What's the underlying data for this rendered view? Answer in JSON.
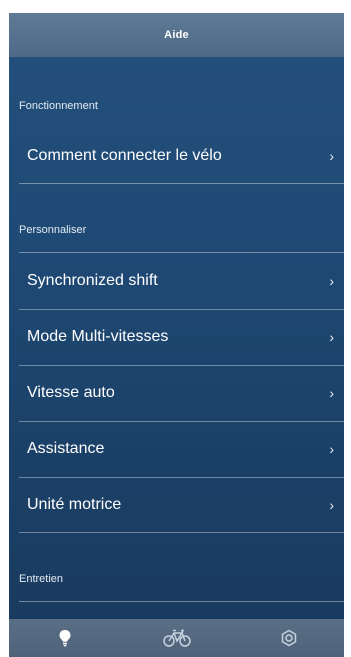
{
  "header": {
    "title": "Aide"
  },
  "sections": [
    {
      "label": "Fonctionnement",
      "items": [
        {
          "label": "Comment connecter le vélo"
        }
      ]
    },
    {
      "label": "Personnaliser",
      "items": [
        {
          "label": "Synchronized shift"
        },
        {
          "label": "Mode Multi-vitesses"
        },
        {
          "label": "Vitesse auto"
        },
        {
          "label": "Assistance"
        },
        {
          "label": "Unité motrice"
        }
      ]
    },
    {
      "label": "Entretien",
      "items": []
    }
  ],
  "chevron": "›",
  "tabs": [
    {
      "icon": "lightbulb-icon",
      "active": true
    },
    {
      "icon": "bicycle-icon",
      "active": false
    },
    {
      "icon": "gear-icon",
      "active": false
    }
  ],
  "colors": {
    "header": "#56718e",
    "background": "#1f4a75",
    "tabbar": "#55697f",
    "active_icon": "#ffffff",
    "inactive_icon": "#c7d2de"
  }
}
